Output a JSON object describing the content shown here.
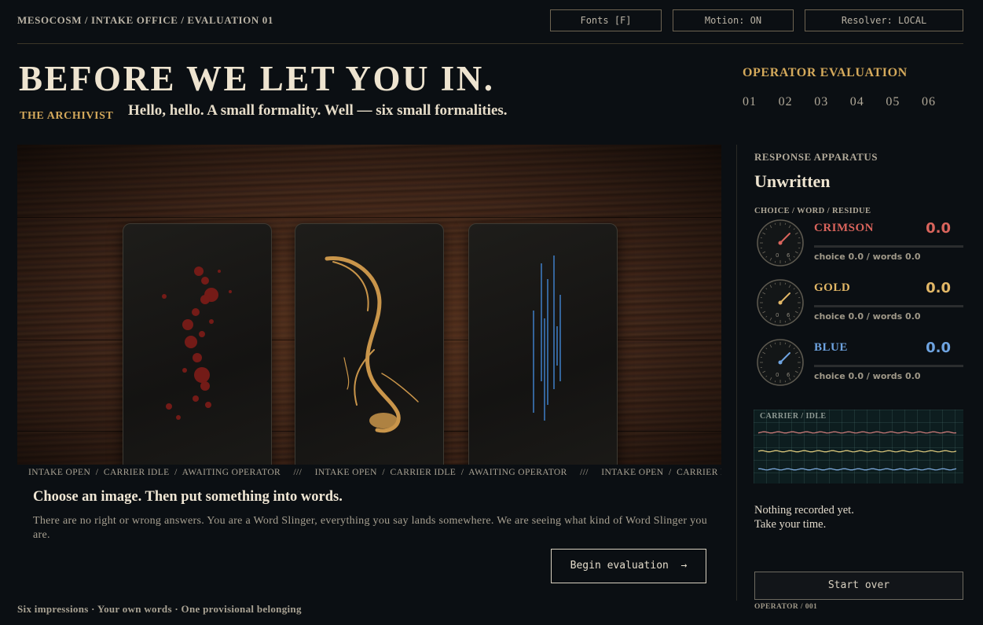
{
  "header": {
    "breadcrumb": "MESOCOSM / INTAKE OFFICE / EVALUATION 01",
    "buttons": {
      "fonts": "Fonts [F]",
      "motion": "Motion: ON",
      "resolver": "Resolver: LOCAL"
    },
    "title": "BEFORE WE LET YOU IN.",
    "speaker": "THE ARCHIVIST",
    "greeting": "Hello, hello. A small formality. Well — six small formalities."
  },
  "evaluation": {
    "label": "OPERATOR EVALUATION",
    "steps": [
      "01",
      "02",
      "03",
      "04",
      "05",
      "06"
    ]
  },
  "stage": {
    "cards": [
      {
        "name": "crimson",
        "mark": "red splatter",
        "color": "#8a1f1a"
      },
      {
        "name": "gold",
        "mark": "gold brush stroke",
        "color": "#c9954a"
      },
      {
        "name": "blue",
        "mark": "blue vertical lines",
        "color": "#3f7fc7"
      }
    ],
    "ticker": "INTAKE OPEN  /  CARRIER IDLE  /  AWAITING OPERATOR     ///     INTAKE OPEN  /  CARRIER IDLE  /  AWAITING OPERATOR     ///     INTAKE OPEN  /  CARRIER IDLE  /  AWAITING OPERATOR"
  },
  "prompt": {
    "title": "Choose an image. Then put something into words.",
    "body": "There are no right or wrong answers. You are a Word Slinger, everything you say lands somewhere. We are seeing what kind of Word Slinger you are.",
    "begin_label": "Begin evaluation  →"
  },
  "footer": {
    "note": "Six impressions · Your own words · One provisional belonging"
  },
  "apparatus": {
    "label": "RESPONSE APPARATUS",
    "state": "Unwritten",
    "subhead": "CHOICE / WORD / RESIDUE",
    "meters": [
      {
        "name": "CRIMSON",
        "value": "0.0",
        "sub": "choice 0.0 / words 0.0",
        "color": "#d9645c",
        "level": 0
      },
      {
        "name": "GOLD",
        "value": "0.0",
        "sub": "choice 0.0 / words 0.0",
        "color": "#e2b766",
        "level": 0
      },
      {
        "name": "BLUE",
        "value": "0.0",
        "sub": "choice 0.0 / words 0.0",
        "color": "#6ea3e0",
        "level": 0
      }
    ],
    "dial_min": "0",
    "dial_max": "6",
    "carrier_label": "CARRIER / IDLE",
    "carrier_colors": [
      "#c97a78",
      "#d8c47a",
      "#7aa6d8"
    ],
    "empty_line1": "Nothing recorded yet.",
    "empty_line2": "Take your time.",
    "start_over": "Start over",
    "operator": "OPERATOR / 001"
  }
}
